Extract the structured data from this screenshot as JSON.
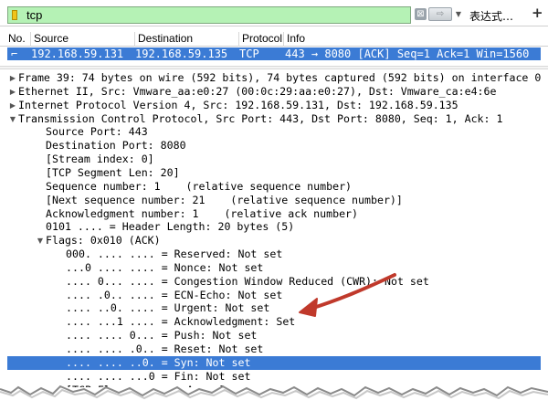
{
  "filter": {
    "value": "tcp",
    "clear_glyph": "⊠",
    "apply_glyph": "⇨",
    "dropdown_glyph": "▼",
    "expression_label": "表达式…",
    "add_label": "+",
    "background_color": "#b5f2b5"
  },
  "packet_list": {
    "columns": [
      "No.",
      "Source",
      "Destination",
      "Protocol",
      "Info"
    ],
    "selected_row": {
      "marker": "⌐",
      "source": "192.168.59.131",
      "destination": "192.168.59.135",
      "protocol": "TCP",
      "info": "443 → 8080 [ACK] Seq=1 Ack=1 Win=1560"
    },
    "selection_color": "#3b7bd5"
  },
  "details": {
    "rows": [
      {
        "indent": 0,
        "toggle": "▶",
        "text": "Frame 39: 74 bytes on wire (592 bits), 74 bytes captured (592 bits) on interface 0"
      },
      {
        "indent": 0,
        "toggle": "▶",
        "text": "Ethernet II, Src: Vmware_aa:e0:27 (00:0c:29:aa:e0:27), Dst: Vmware_ca:e4:6e"
      },
      {
        "indent": 0,
        "toggle": "▶",
        "text": "Internet Protocol Version 4, Src: 192.168.59.131, Dst: 192.168.59.135"
      },
      {
        "indent": 0,
        "toggle": "▼",
        "text": "Transmission Control Protocol, Src Port: 443, Dst Port: 8080, Seq: 1, Ack: 1"
      },
      {
        "indent": 1,
        "toggle": "",
        "text": "Source Port: 443"
      },
      {
        "indent": 1,
        "toggle": "",
        "text": "Destination Port: 8080"
      },
      {
        "indent": 1,
        "toggle": "",
        "text": "[Stream index: 0]"
      },
      {
        "indent": 1,
        "toggle": "",
        "text": "[TCP Segment Len: 20]"
      },
      {
        "indent": 1,
        "toggle": "",
        "text": "Sequence number: 1    (relative sequence number)"
      },
      {
        "indent": 1,
        "toggle": "",
        "text": "[Next sequence number: 21    (relative sequence number)]"
      },
      {
        "indent": 1,
        "toggle": "",
        "text": "Acknowledgment number: 1    (relative ack number)"
      },
      {
        "indent": 1,
        "toggle": "",
        "text": "0101 .... = Header Length: 20 bytes (5)"
      },
      {
        "indent": 1,
        "toggle": "▼",
        "text": "Flags: 0x010 (ACK)"
      },
      {
        "indent": 2,
        "toggle": "",
        "text": "000. .... .... = Reserved: Not set"
      },
      {
        "indent": 2,
        "toggle": "",
        "text": "...0 .... .... = Nonce: Not set"
      },
      {
        "indent": 2,
        "toggle": "",
        "text": ".... 0... .... = Congestion Window Reduced (CWR): Not set"
      },
      {
        "indent": 2,
        "toggle": "",
        "text": ".... .0.. .... = ECN-Echo: Not set"
      },
      {
        "indent": 2,
        "toggle": "",
        "text": ".... ..0. .... = Urgent: Not set"
      },
      {
        "indent": 2,
        "toggle": "",
        "text": ".... ...1 .... = Acknowledgment: Set"
      },
      {
        "indent": 2,
        "toggle": "",
        "text": ".... .... 0... = Push: Not set"
      },
      {
        "indent": 2,
        "toggle": "",
        "text": ".... .... .0.. = Reset: Not set"
      },
      {
        "indent": 2,
        "toggle": "",
        "text": ".... .... ..0. = Syn: Not set",
        "selected": true
      },
      {
        "indent": 2,
        "toggle": "",
        "text": ".... .... ...0 = Fin: Not set"
      },
      {
        "indent": 2,
        "toggle": "",
        "text": "[TCP Flags: ·······A····]"
      }
    ]
  },
  "annotation": {
    "arrow_color": "#c0392b"
  }
}
